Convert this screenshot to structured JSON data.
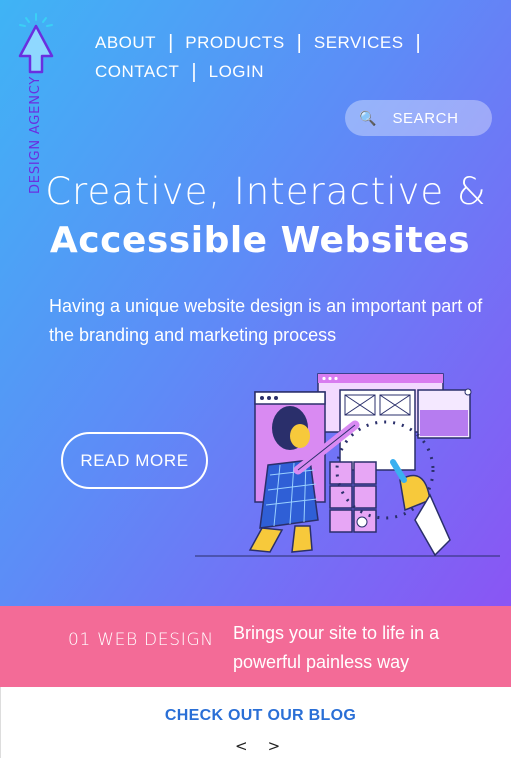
{
  "brand": {
    "name": "DESIGN AGENCY"
  },
  "nav": {
    "items": [
      {
        "label": "ABOUT"
      },
      {
        "label": "PRODUCTS"
      },
      {
        "label": "SERVICES"
      },
      {
        "label": "CONTACT"
      },
      {
        "label": "LOGIN"
      }
    ]
  },
  "search": {
    "placeholder": "SEARCH",
    "icon": "search-icon"
  },
  "hero": {
    "title_line1": "Creative, Interactive &",
    "title_line2": "Accessible Websites",
    "subtitle": "Having a unique website design is an important part of the branding and marketing process",
    "cta_label": "READ MORE"
  },
  "service": {
    "title": "01 WEB DESIGN",
    "description": "Brings your site to life in a powerful painless way"
  },
  "footer": {
    "blog_label": "CHECK OUT OUR BLOG",
    "prev_label": "<",
    "next_label": ">"
  },
  "colors": {
    "gradient_start": "#3fb4f5",
    "gradient_end": "#8a55f4",
    "band": "#f36b97",
    "link": "#2a6fd6",
    "brand_text": "#6a2fe0"
  }
}
